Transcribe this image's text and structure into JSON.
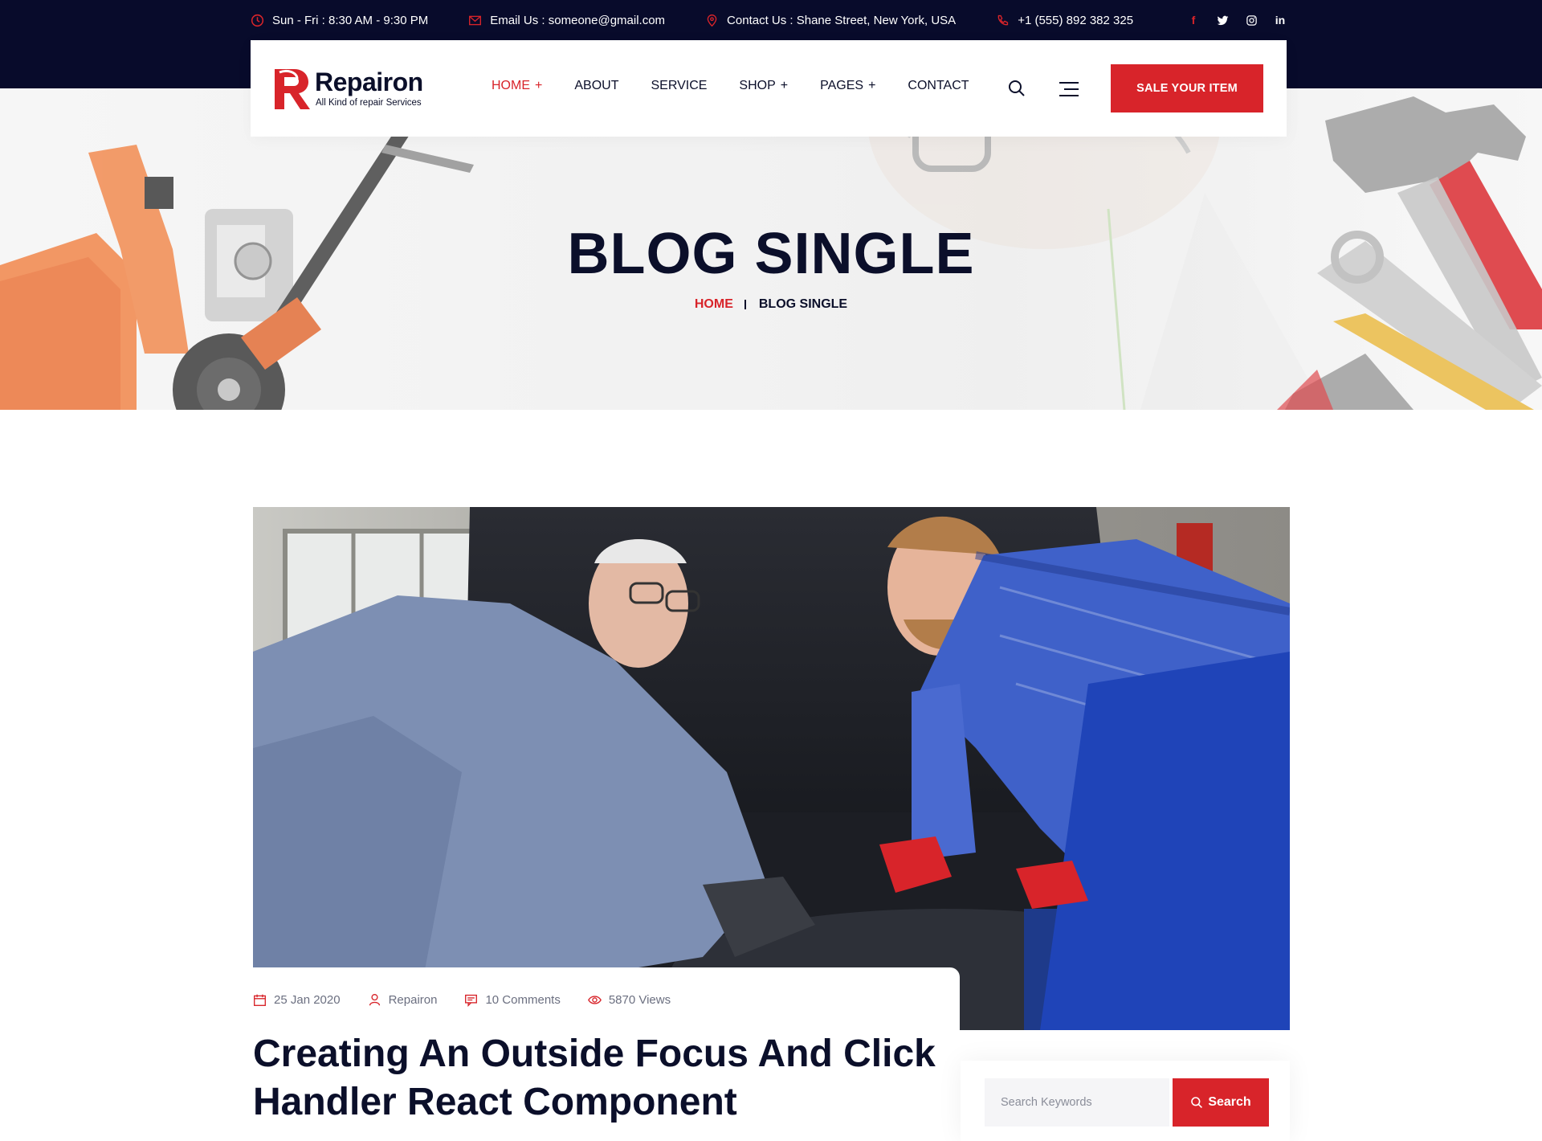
{
  "topbar": {
    "hours": "Sun - Fri : 8:30 AM - 9:30 PM",
    "email": "Email Us : someone@gmail.com",
    "address": "Contact Us : Shane Street, New York, USA",
    "phone": "+1 (555) 892 382 325",
    "socials": [
      "facebook-icon",
      "twitter-icon",
      "instagram-icon",
      "linkedin-icon"
    ]
  },
  "logo": {
    "name": "Repairon",
    "tagline": "All Kind of repair Services"
  },
  "nav": {
    "items": [
      {
        "label": "HOME",
        "has_submenu": true,
        "active": true
      },
      {
        "label": "ABOUT",
        "has_submenu": false
      },
      {
        "label": "SERVICE",
        "has_submenu": false
      },
      {
        "label": "SHOP",
        "has_submenu": true
      },
      {
        "label": "PAGES",
        "has_submenu": true
      },
      {
        "label": "CONTACT",
        "has_submenu": false
      }
    ],
    "plus": "+",
    "cta": "SALE YOUR ITEM"
  },
  "hero": {
    "title": "BLOG SINGLE",
    "breadcrumb_home": "HOME",
    "breadcrumb_current": "BLOG SINGLE"
  },
  "post": {
    "date": "25 Jan 2020",
    "author": "Repairon",
    "comments": "10 Comments",
    "views": "5870 Views",
    "title": "Creating An Outside Focus And Click Handler React Component"
  },
  "sidebar": {
    "search_placeholder": "Search Keywords",
    "search_button": "Search"
  },
  "colors": {
    "accent": "#d8242a",
    "dark": "#080b2b",
    "text": "#0b0f2a",
    "muted": "#6b6f80"
  }
}
